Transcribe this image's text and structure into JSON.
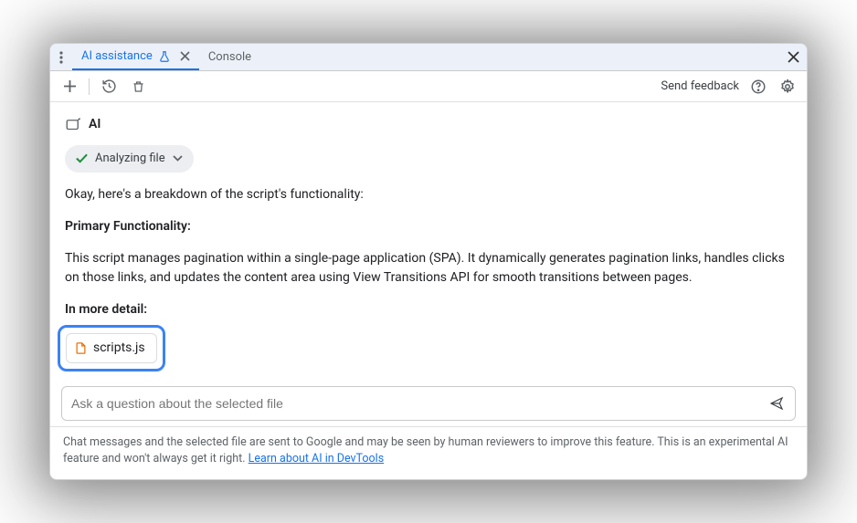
{
  "tabs": {
    "active": {
      "label": "AI assistance"
    },
    "other": {
      "label": "Console"
    }
  },
  "toolbar": {
    "feedback": "Send feedback"
  },
  "ai": {
    "label": "AI",
    "status": "Analyzing file"
  },
  "response": {
    "intro": "Okay, here's a breakdown of the script's functionality:",
    "heading1": "Primary Functionality:",
    "body1": "This script manages pagination within a single-page application (SPA). It dynamically generates pagination links, handles clicks on those links, and updates the content area using View Transitions API for smooth transitions between pages.",
    "heading2": "In more detail:"
  },
  "file": {
    "name": "scripts.js"
  },
  "input": {
    "placeholder": "Ask a question about the selected file"
  },
  "disclaimer": {
    "text": "Chat messages and the selected file are sent to Google and may be seen by human reviewers to improve this feature. This is an experimental AI feature and won't always get it right. ",
    "link": "Learn about AI in DevTools"
  }
}
